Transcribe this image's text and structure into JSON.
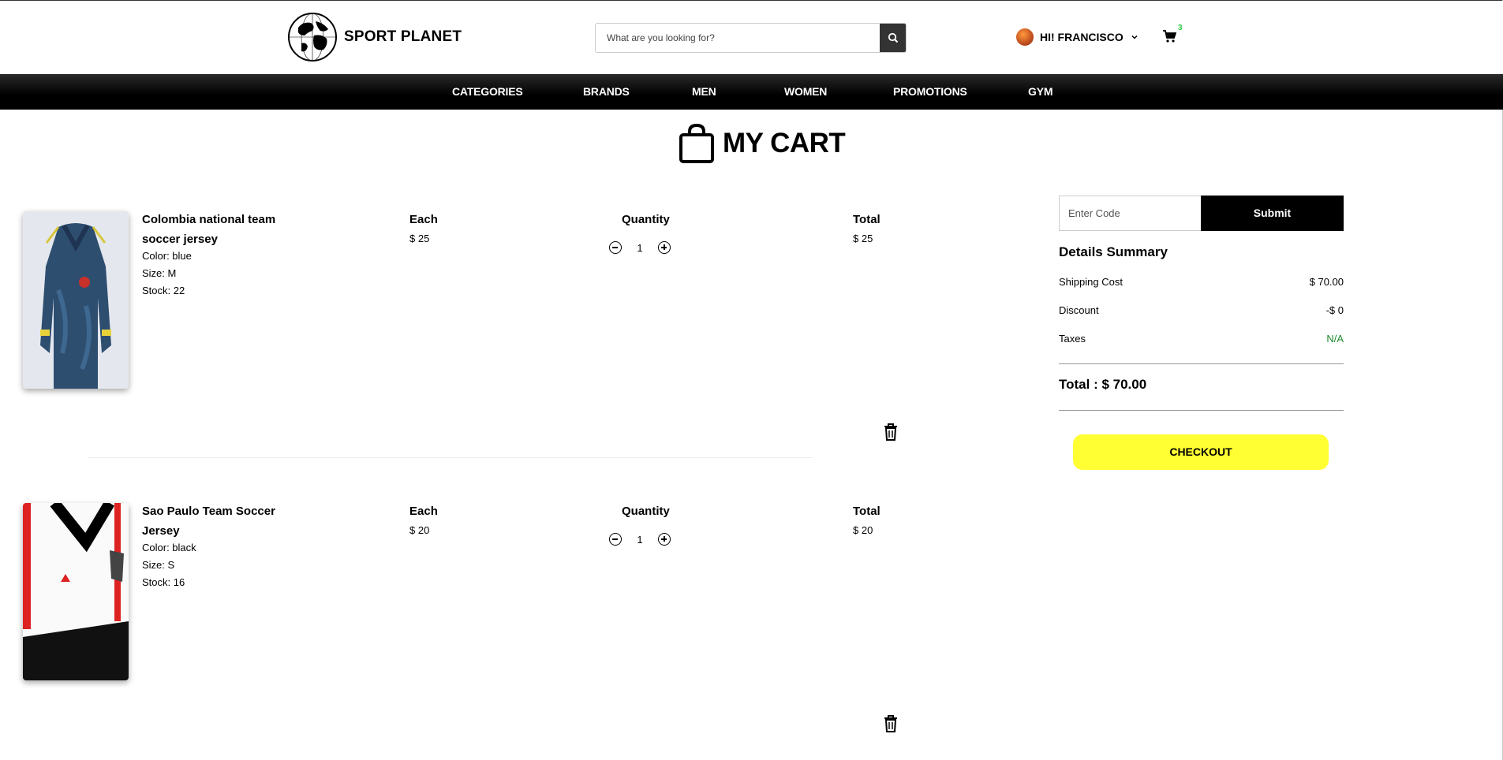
{
  "header": {
    "brand": "SPORT PLANET",
    "search_placeholder": "What are you looking for?",
    "user_greeting": "HI! FRANCISCO",
    "cart_count": "3"
  },
  "nav": {
    "items": [
      "CATEGORIES",
      "BRANDS",
      "MEN",
      "WOMEN",
      "PROMOTIONS",
      "GYM"
    ]
  },
  "page": {
    "title": "MY CART"
  },
  "cart": {
    "col_each": "Each",
    "col_quantity": "Quantity",
    "col_total": "Total",
    "items": [
      {
        "name": "Colombia national team soccer jersey",
        "color": "Color: blue",
        "size": "Size: M",
        "stock": "Stock: 22",
        "each": "$ 25",
        "quantity": "1",
        "total": "$ 25"
      },
      {
        "name": "Sao Paulo Team Soccer Jersey",
        "color": "Color: black",
        "size": "Size: S",
        "stock": "Stock: 16",
        "each": "$ 20",
        "quantity": "1",
        "total": "$ 20"
      }
    ]
  },
  "summary": {
    "code_placeholder": "Enter Code",
    "submit_label": "Submit",
    "title": "Details Summary",
    "shipping_label": "Shipping Cost",
    "shipping_value": "$ 70.00",
    "discount_label": "Discount",
    "discount_value": "-$ 0",
    "taxes_label": "Taxes",
    "taxes_value": "N/A",
    "total": "Total : $ 70.00",
    "checkout_label": "CHECKOUT"
  },
  "colors": {
    "nav_bg": "#000000",
    "checkout_bg": "#ffff33",
    "badge": "#2ecc40",
    "taxes_green": "#1e8c2e"
  }
}
